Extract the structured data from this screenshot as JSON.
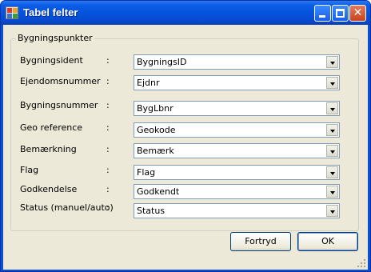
{
  "window": {
    "title": "Tabel felter",
    "icon": "table-grid-icon"
  },
  "titlebar_buttons": {
    "minimize": "minimize-icon",
    "maximize": "maximize-icon",
    "close": "close-icon",
    "close_glyph": "✕"
  },
  "group": {
    "title": "Bygningspunkter",
    "rows": [
      {
        "label": "Bygningsident",
        "colon": ":",
        "value": "BygningsID"
      },
      {
        "label": "Ejendomsnummer",
        "colon": ":",
        "value": "Ejdnr"
      },
      {
        "label": "Bygningsnummer",
        "colon": ":",
        "value": "BygLbnr"
      },
      {
        "label": "Geo reference",
        "colon": ":",
        "value": "Geokode"
      },
      {
        "label": "Bemærkning",
        "colon": ":",
        "value": "Bemærk"
      },
      {
        "label": "Flag",
        "colon": ":",
        "value": "Flag"
      },
      {
        "label": "Godkendelse",
        "colon": ":",
        "value": "Godkendt"
      },
      {
        "label": "Status (manuel/auto)",
        "colon": ":",
        "value": "Status"
      }
    ]
  },
  "buttons": {
    "cancel": "Fortryd",
    "ok": "OK"
  }
}
